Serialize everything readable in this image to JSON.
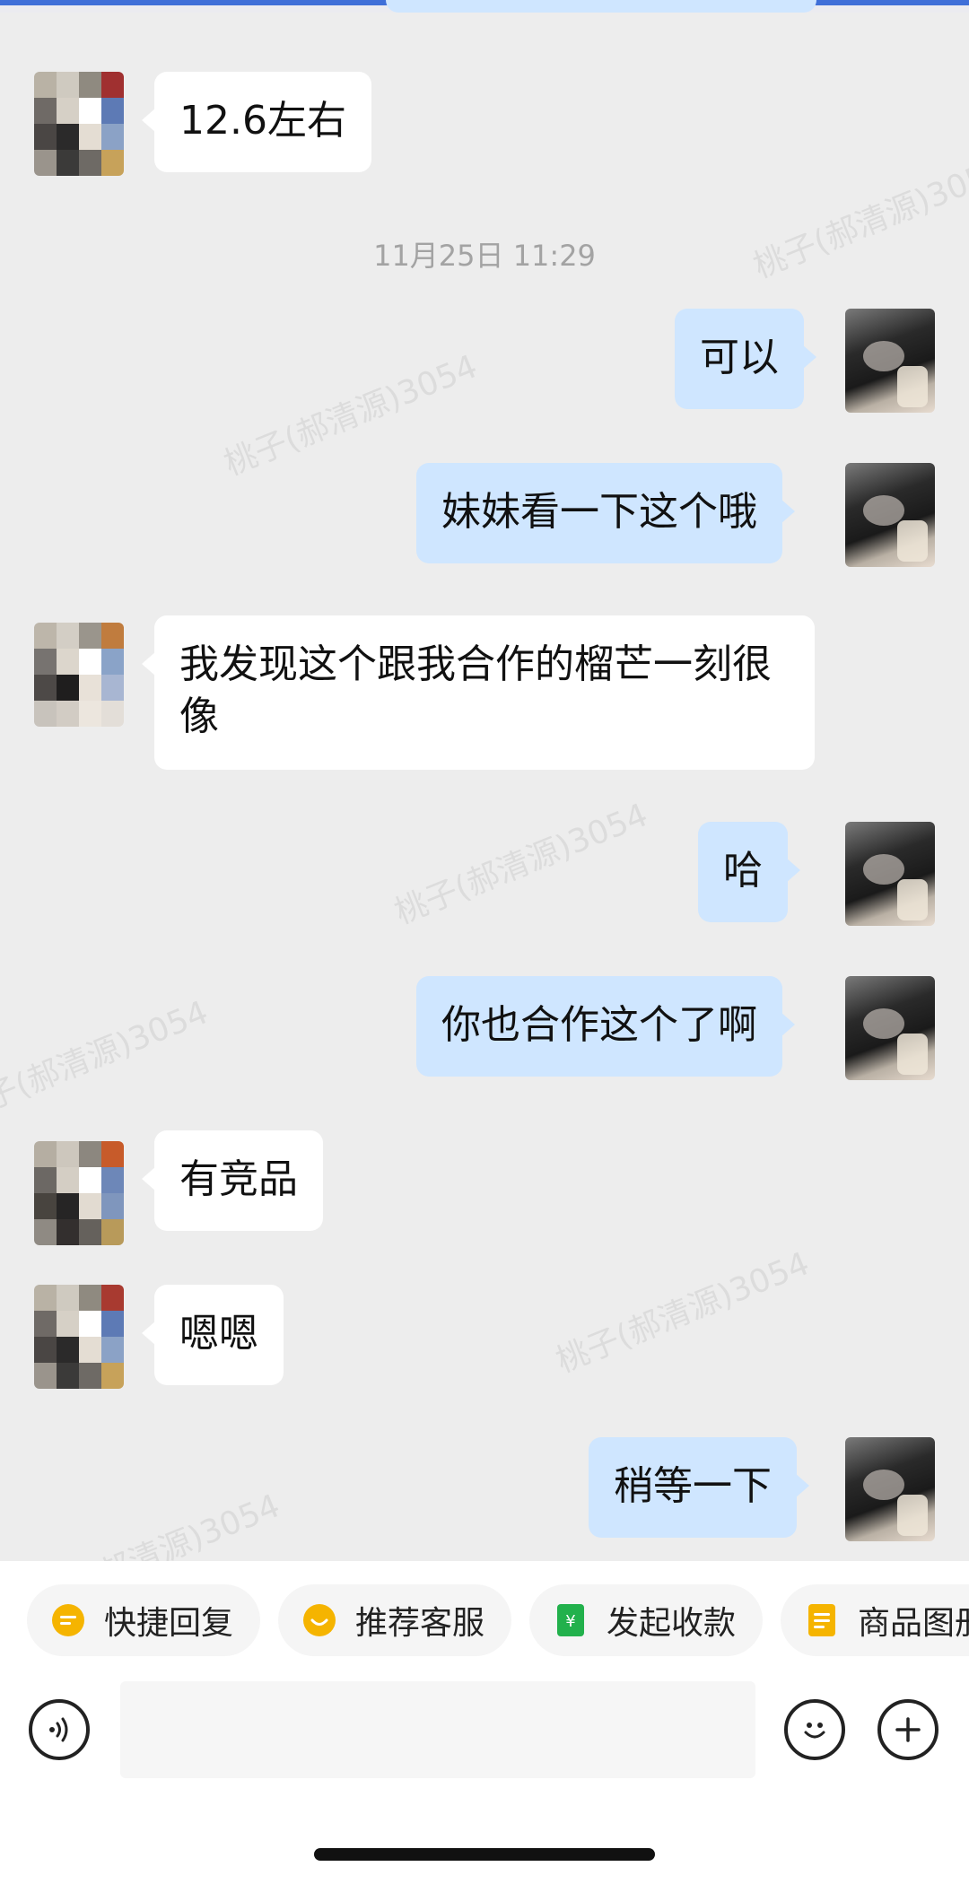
{
  "timestamp": "11月25日 11:29",
  "messages": [
    {
      "side": "left",
      "text": "12.6左右"
    },
    {
      "side": "right",
      "text": "可以"
    },
    {
      "side": "right",
      "text": "妹妹看一下这个哦"
    },
    {
      "side": "left",
      "text": "我发现这个跟我合作的榴芒一刻很像"
    },
    {
      "side": "right",
      "text": "哈"
    },
    {
      "side": "right",
      "text": "你也合作这个了啊"
    },
    {
      "side": "left",
      "text": "有竞品"
    },
    {
      "side": "left",
      "text": "嗯嗯"
    },
    {
      "side": "right",
      "text": "稍等一下"
    }
  ],
  "watermark_text": "桃子(郝清源)3054",
  "quick_actions": [
    {
      "label": "快捷回复",
      "icon": "quick-reply-icon",
      "color": "#f5b400"
    },
    {
      "label": "推荐客服",
      "icon": "recommend-service-icon",
      "color": "#f5b400"
    },
    {
      "label": "发起收款",
      "icon": "payment-icon",
      "color": "#22b14c"
    },
    {
      "label": "商品图册",
      "icon": "product-album-icon",
      "color": "#f5b400"
    }
  ],
  "input": {
    "placeholder": ""
  },
  "colors": {
    "chat_bg": "#ededed",
    "left_bubble": "#ffffff",
    "right_bubble": "#cfe6ff",
    "accent_blue": "#3f6fd8"
  }
}
